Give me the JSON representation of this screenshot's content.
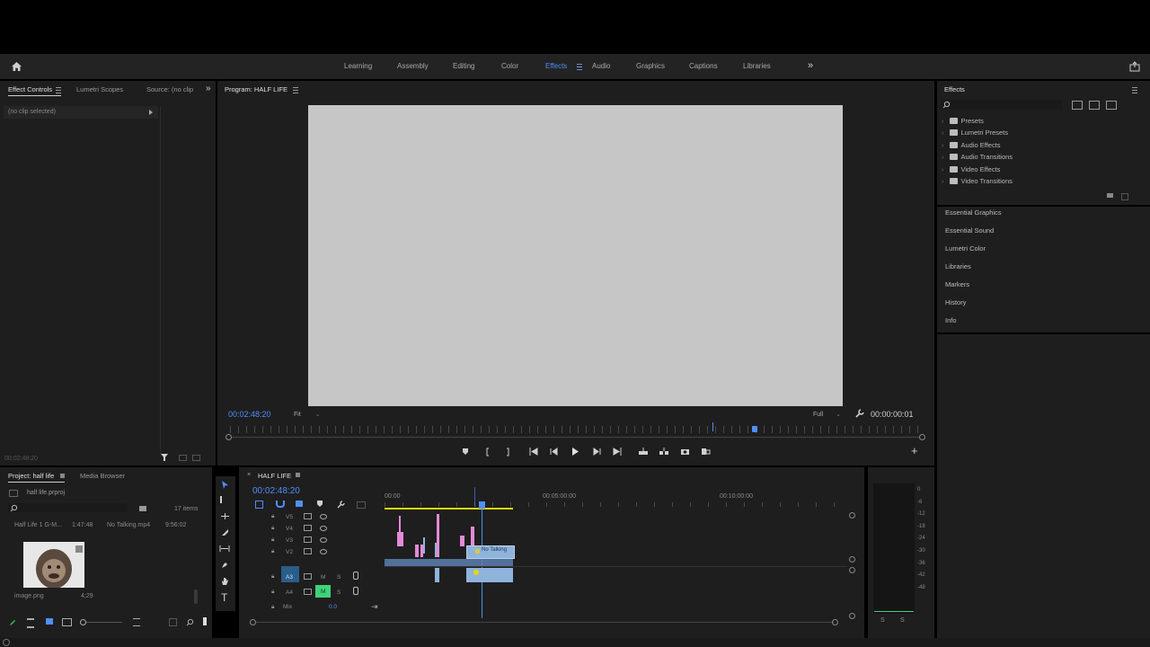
{
  "topbar": {
    "workspaces": [
      "Learning",
      "Assembly",
      "Editing",
      "Color",
      "Effects",
      "Audio",
      "Graphics",
      "Captions",
      "Libraries"
    ],
    "active_workspace": "Effects",
    "more_symbol": "»"
  },
  "effect_controls": {
    "tab_label": "Effect Controls",
    "tab2": "Lumetri Scopes",
    "tab3": "Source: (no clip",
    "more": "»",
    "no_clip": "(no clip selected)",
    "footer_time": "00:02:48:20"
  },
  "program": {
    "title": "Program: HALF LIFE",
    "timecode": "00:02:48:20",
    "fit": "Fit",
    "quality": "Full",
    "duration": "00:00:00:01"
  },
  "effects": {
    "title": "Effects",
    "tree": [
      "Presets",
      "Lumetri Presets",
      "Audio Effects",
      "Audio Transitions",
      "Video Effects",
      "Video Transitions"
    ],
    "panels": [
      "Essential Graphics",
      "Essential Sound",
      "Lumetri Color",
      "Libraries",
      "Markers",
      "History",
      "Info"
    ]
  },
  "project": {
    "tab_label": "Project: half life",
    "tab2": "Media Browser",
    "file": "half life.prproj",
    "item_count": "17 items",
    "items": [
      {
        "name": "Half Life 1 G-M...",
        "duration": "1:47:48"
      },
      {
        "name": "No Talking.mp4",
        "duration": "9:56:02"
      },
      {
        "name": "image.png",
        "duration": "4;29"
      }
    ]
  },
  "timeline": {
    "sequence_name": "HALF LIFE",
    "timecode": "00:02:48:20",
    "ruler": [
      "00:00",
      "00:05:00:00",
      "00:10:00:00"
    ],
    "video_tracks": [
      "V5",
      "V4",
      "V3",
      "V2"
    ],
    "audio_tracks": [
      "A3",
      "A4"
    ],
    "mix_label": "Mix",
    "mix_value": "0.0",
    "clip_label": "No Talking",
    "m_label": "M",
    "s_label": "S"
  },
  "meter": {
    "scale": [
      "0",
      "-6",
      "-12",
      "-18",
      "-24",
      "-30",
      "-36",
      "-42",
      "-48"
    ],
    "solo": [
      "S",
      "S"
    ]
  },
  "colors": {
    "accent": "#4f8ff7",
    "panel": "#1e1e1e",
    "video_clip": "#e48ad7",
    "audio_clip": "#8fb4dc",
    "playhead": "#4f8ff7"
  }
}
